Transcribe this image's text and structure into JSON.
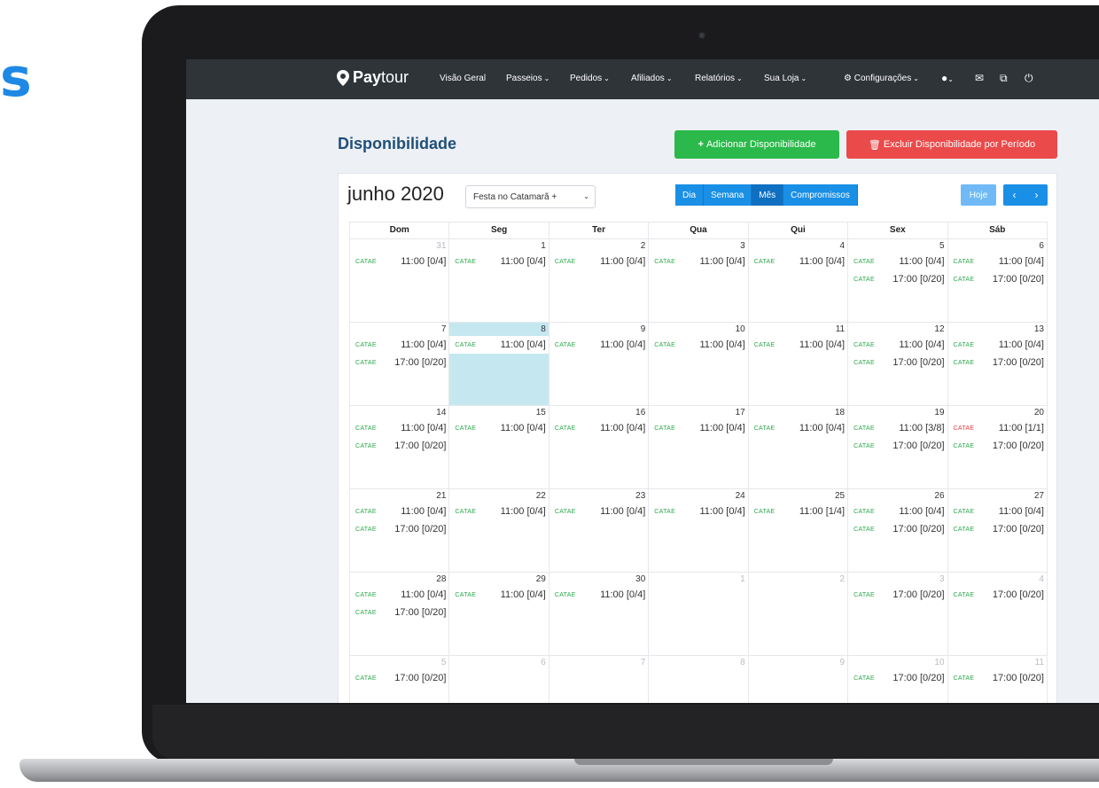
{
  "side_letter": "s",
  "nav": {
    "brand_bold": "Pay",
    "brand_light": "tour",
    "items": [
      "Visão Geral",
      "Passeios",
      "Pedidos",
      "Afiliados",
      "Relatórios",
      "Sua Loja",
      "Configurações"
    ]
  },
  "page": {
    "title": "Disponibilidade",
    "add_button": "Adicionar Disponibilidade",
    "delete_button": "Excluir Disponibilidade por Período"
  },
  "calendar": {
    "month_title": "junho 2020",
    "tour_select": "Festa no Catamarã +",
    "views": [
      "Dia",
      "Semana",
      "Mês",
      "Compromissos"
    ],
    "active_view": "Mês",
    "today_button": "Hoje",
    "weekdays": [
      "Dom",
      "Seg",
      "Ter",
      "Qua",
      "Qui",
      "Sex",
      "Sáb"
    ],
    "weeks": [
      [
        {
          "day": "31",
          "other": true,
          "events": [
            {
              "tag": "CATAE",
              "time": "11:00",
              "count": "[0/4]"
            }
          ]
        },
        {
          "day": "1",
          "events": [
            {
              "tag": "CATAE",
              "time": "11:00",
              "count": "[0/4]"
            }
          ]
        },
        {
          "day": "2",
          "events": [
            {
              "tag": "CATAE",
              "time": "11:00",
              "count": "[0/4]"
            }
          ]
        },
        {
          "day": "3",
          "events": [
            {
              "tag": "CATAE",
              "time": "11:00",
              "count": "[0/4]"
            }
          ]
        },
        {
          "day": "4",
          "events": [
            {
              "tag": "CATAE",
              "time": "11:00",
              "count": "[0/4]"
            }
          ]
        },
        {
          "day": "5",
          "events": [
            {
              "tag": "CATAE",
              "time": "11:00",
              "count": "[0/4]"
            },
            {
              "tag": "CATAE",
              "time": "17:00",
              "count": "[0/20]"
            }
          ]
        },
        {
          "day": "6",
          "events": [
            {
              "tag": "CATAE",
              "time": "11:00",
              "count": "[0/4]"
            },
            {
              "tag": "CATAE",
              "time": "17:00",
              "count": "[0/20]"
            }
          ]
        }
      ],
      [
        {
          "day": "7",
          "events": [
            {
              "tag": "CATAE",
              "time": "11:00",
              "count": "[0/4]"
            },
            {
              "tag": "CATAE",
              "time": "17:00",
              "count": "[0/20]"
            }
          ]
        },
        {
          "day": "8",
          "today": true,
          "events": [
            {
              "tag": "CATAE",
              "time": "11:00",
              "count": "[0/4]"
            }
          ]
        },
        {
          "day": "9",
          "events": [
            {
              "tag": "CATAE",
              "time": "11:00",
              "count": "[0/4]"
            }
          ]
        },
        {
          "day": "10",
          "events": [
            {
              "tag": "CATAE",
              "time": "11:00",
              "count": "[0/4]"
            }
          ]
        },
        {
          "day": "11",
          "events": [
            {
              "tag": "CATAE",
              "time": "11:00",
              "count": "[0/4]"
            }
          ]
        },
        {
          "day": "12",
          "events": [
            {
              "tag": "CATAE",
              "time": "11:00",
              "count": "[0/4]"
            },
            {
              "tag": "CATAE",
              "time": "17:00",
              "count": "[0/20]"
            }
          ]
        },
        {
          "day": "13",
          "events": [
            {
              "tag": "CATAE",
              "time": "11:00",
              "count": "[0/4]"
            },
            {
              "tag": "CATAE",
              "time": "17:00",
              "count": "[0/20]"
            }
          ]
        }
      ],
      [
        {
          "day": "14",
          "events": [
            {
              "tag": "CATAE",
              "time": "11:00",
              "count": "[0/4]"
            },
            {
              "tag": "CATAE",
              "time": "17:00",
              "count": "[0/20]"
            }
          ]
        },
        {
          "day": "15",
          "events": [
            {
              "tag": "CATAE",
              "time": "11:00",
              "count": "[0/4]"
            }
          ]
        },
        {
          "day": "16",
          "events": [
            {
              "tag": "CATAE",
              "time": "11:00",
              "count": "[0/4]"
            }
          ]
        },
        {
          "day": "17",
          "events": [
            {
              "tag": "CATAE",
              "time": "11:00",
              "count": "[0/4]"
            }
          ]
        },
        {
          "day": "18",
          "events": [
            {
              "tag": "CATAE",
              "time": "11:00",
              "count": "[0/4]"
            }
          ]
        },
        {
          "day": "19",
          "events": [
            {
              "tag": "CATAE",
              "time": "11:00",
              "count": "[3/8]"
            },
            {
              "tag": "CATAE",
              "time": "17:00",
              "count": "[0/20]"
            }
          ]
        },
        {
          "day": "20",
          "events": [
            {
              "tag": "CATAE",
              "time": "11:00",
              "count": "[1/1]",
              "full": true
            },
            {
              "tag": "CATAE",
              "time": "17:00",
              "count": "[0/20]"
            }
          ]
        }
      ],
      [
        {
          "day": "21",
          "events": [
            {
              "tag": "CATAE",
              "time": "11:00",
              "count": "[0/4]"
            },
            {
              "tag": "CATAE",
              "time": "17:00",
              "count": "[0/20]"
            }
          ]
        },
        {
          "day": "22",
          "events": [
            {
              "tag": "CATAE",
              "time": "11:00",
              "count": "[0/4]"
            }
          ]
        },
        {
          "day": "23",
          "events": [
            {
              "tag": "CATAE",
              "time": "11:00",
              "count": "[0/4]"
            }
          ]
        },
        {
          "day": "24",
          "events": [
            {
              "tag": "CATAE",
              "time": "11:00",
              "count": "[0/4]"
            }
          ]
        },
        {
          "day": "25",
          "events": [
            {
              "tag": "CATAE",
              "time": "11:00",
              "count": "[1/4]"
            }
          ]
        },
        {
          "day": "26",
          "events": [
            {
              "tag": "CATAE",
              "time": "11:00",
              "count": "[0/4]"
            },
            {
              "tag": "CATAE",
              "time": "17:00",
              "count": "[0/20]"
            }
          ]
        },
        {
          "day": "27",
          "events": [
            {
              "tag": "CATAE",
              "time": "11:00",
              "count": "[0/4]"
            },
            {
              "tag": "CATAE",
              "time": "17:00",
              "count": "[0/20]"
            }
          ]
        }
      ],
      [
        {
          "day": "28",
          "events": [
            {
              "tag": "CATAE",
              "time": "11:00",
              "count": "[0/4]"
            },
            {
              "tag": "CATAE",
              "time": "17:00",
              "count": "[0/20]"
            }
          ]
        },
        {
          "day": "29",
          "events": [
            {
              "tag": "CATAE",
              "time": "11:00",
              "count": "[0/4]"
            }
          ]
        },
        {
          "day": "30",
          "events": [
            {
              "tag": "CATAE",
              "time": "11:00",
              "count": "[0/4]"
            }
          ]
        },
        {
          "day": "1",
          "other": true,
          "events": []
        },
        {
          "day": "2",
          "other": true,
          "events": []
        },
        {
          "day": "3",
          "other": true,
          "events": [
            {
              "tag": "CATAE",
              "time": "17:00",
              "count": "[0/20]"
            }
          ]
        },
        {
          "day": "4",
          "other": true,
          "events": [
            {
              "tag": "CATAE",
              "time": "17:00",
              "count": "[0/20]"
            }
          ]
        }
      ],
      [
        {
          "day": "5",
          "other": true,
          "events": [
            {
              "tag": "CATAE",
              "time": "17:00",
              "count": "[0/20]"
            }
          ]
        },
        {
          "day": "6",
          "other": true,
          "events": []
        },
        {
          "day": "7",
          "other": true,
          "events": []
        },
        {
          "day": "8",
          "other": true,
          "events": []
        },
        {
          "day": "9",
          "other": true,
          "events": []
        },
        {
          "day": "10",
          "other": true,
          "events": [
            {
              "tag": "CATAE",
              "time": "17:00",
              "count": "[0/20]"
            }
          ]
        },
        {
          "day": "11",
          "other": true,
          "events": [
            {
              "tag": "CATAE",
              "time": "17:00",
              "count": "[0/20]"
            }
          ]
        }
      ]
    ]
  }
}
